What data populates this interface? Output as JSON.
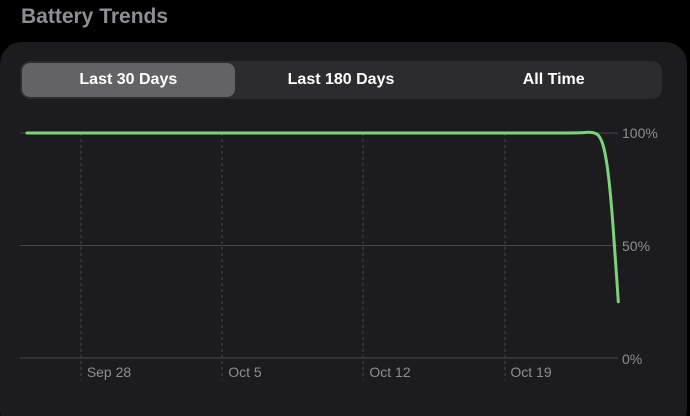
{
  "header": {
    "title": "Battery Trends"
  },
  "segments": [
    {
      "label": "Last 30 Days",
      "selected": true
    },
    {
      "label": "Last 180 Days",
      "selected": false
    },
    {
      "label": "All Time",
      "selected": false
    }
  ],
  "colors": {
    "line": "#7ed27a",
    "grid": "#48484a",
    "card": "#1c1c1e",
    "selected_segment": "#636366"
  },
  "chart_data": {
    "type": "line",
    "x_ticks": [
      "Sep 28",
      "Oct 5",
      "Oct 12",
      "Oct 19"
    ],
    "y_ticks": [
      "100%",
      "50%",
      "0%"
    ],
    "ylim": [
      0,
      100
    ],
    "series": [
      {
        "values": [
          {
            "day": 0,
            "value": 100
          },
          {
            "day": 20,
            "value": 100
          },
          {
            "day": 25,
            "value": 100
          },
          {
            "day": 27.4,
            "value": 100
          },
          {
            "day": 27.9,
            "value": 100.5
          },
          {
            "day": 28.3,
            "value": 99
          },
          {
            "day": 28.6,
            "value": 90
          },
          {
            "day": 28.85,
            "value": 70
          },
          {
            "day": 29.05,
            "value": 45
          },
          {
            "day": 29.2,
            "value": 25
          }
        ]
      }
    ]
  }
}
